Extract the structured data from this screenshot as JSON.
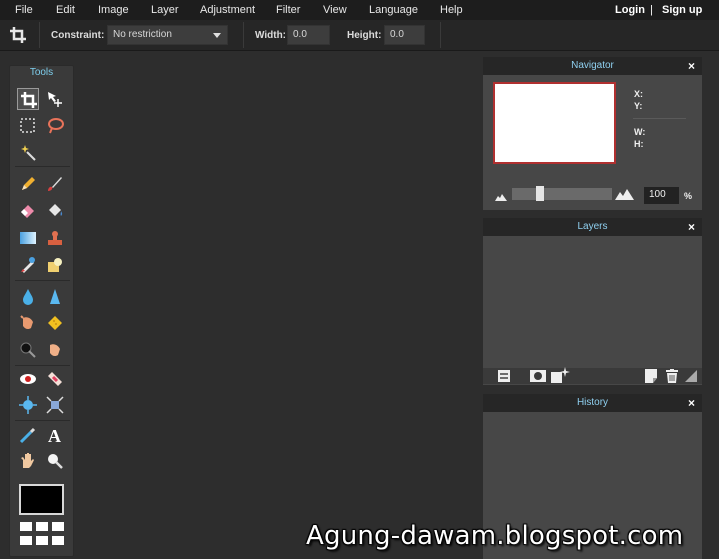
{
  "menu": {
    "items": [
      "File",
      "Edit",
      "Image",
      "Layer",
      "Adjustment",
      "Filter",
      "View",
      "Language",
      "Help"
    ],
    "login": "Login",
    "separator": "|",
    "signup": "Sign up"
  },
  "options": {
    "constraint_label": "Constraint:",
    "constraint_value": "No restriction",
    "width_label": "Width:",
    "width_value": "0.0",
    "height_label": "Height:",
    "height_value": "0.0"
  },
  "tools": {
    "title": "Tools",
    "active_tool": "crop-icon"
  },
  "navigator": {
    "title": "Navigator",
    "x_label": "X:",
    "y_label": "Y:",
    "w_label": "W:",
    "h_label": "H:",
    "zoom_value": "100",
    "zoom_unit": "%",
    "close": "×"
  },
  "layers": {
    "title": "Layers",
    "close": "×"
  },
  "history": {
    "title": "History",
    "close": "×"
  },
  "watermark": "Agung-dawam.blogspot.com",
  "colors": {
    "accent": "#7ecfee",
    "canvas_border": "#b03030",
    "foreground_color": "#000000"
  }
}
